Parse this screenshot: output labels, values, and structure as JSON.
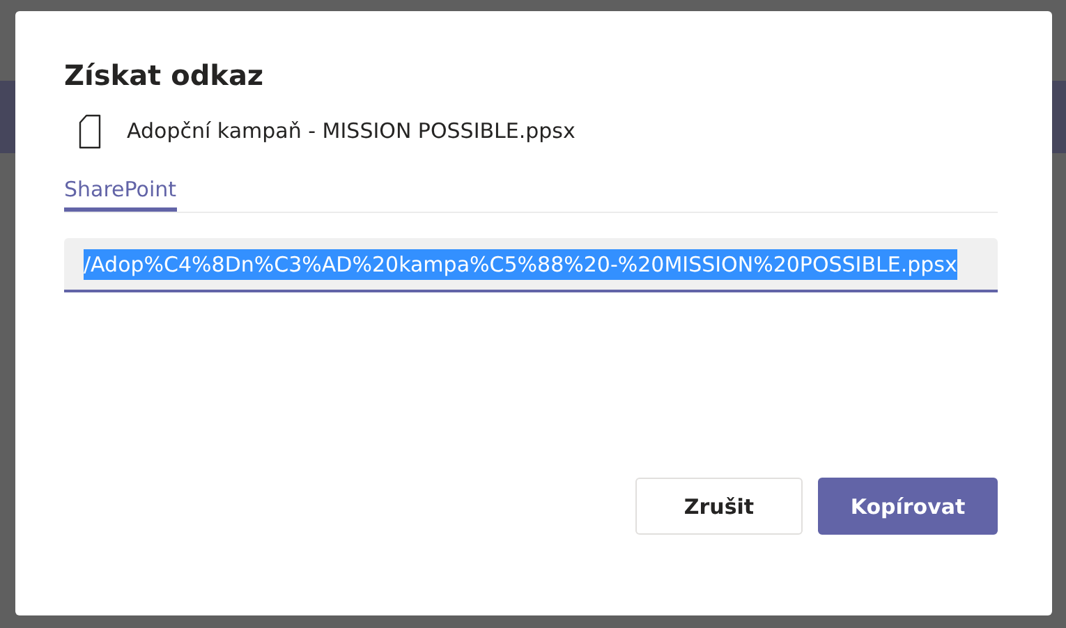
{
  "dialog": {
    "title": "Získat odkaz",
    "file_name": "Adopční kampaň - MISSION POSSIBLE.ppsx",
    "tabs": [
      {
        "label": "SharePoint",
        "selected": true
      }
    ],
    "link_field": {
      "value": "/Adop%C4%8Dn%C3%AD%20kampa%C5%88%20-%20MISSION%20POSSIBLE.ppsx",
      "text_selected": true
    },
    "buttons": [
      {
        "label": "Zrušit",
        "kind": "secondary"
      },
      {
        "label": "Kopírovat",
        "kind": "primary"
      }
    ]
  }
}
